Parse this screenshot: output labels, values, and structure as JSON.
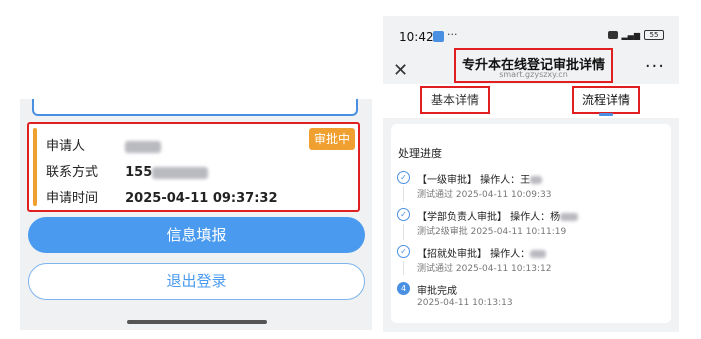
{
  "left": {
    "status_badge": "审批中",
    "rows": [
      {
        "label": "申请人",
        "value": ""
      },
      {
        "label": "联系方式",
        "value": "155"
      },
      {
        "label": "申请时间",
        "value": "2025-04-11 09:37:32"
      }
    ],
    "primary_button": "信息填报",
    "secondary_button": "退出登录"
  },
  "right": {
    "status_bar": {
      "time": "10:42",
      "dots": "···",
      "battery": "55"
    },
    "nav": {
      "close": "✕",
      "title": "专升本在线登记审批详情",
      "subtitle": "smart.gzyszxy.cn",
      "more": "···"
    },
    "tabs": [
      {
        "label": "基本详情"
      },
      {
        "label": "流程详情"
      }
    ],
    "process_title": "处理进度",
    "steps": [
      {
        "icon": "✓",
        "title": "【一级审批】 操作人：王",
        "detail": "测试通过 2025-04-11 10:09:33"
      },
      {
        "icon": "✓",
        "title": "【学部负责人审批】 操作人：杨",
        "detail": "测试2级审批 2025-04-11 10:11:19"
      },
      {
        "icon": "✓",
        "title": "【招就处审批】 操作人：",
        "detail": "测试通过 2025-04-11 10:13:12"
      },
      {
        "icon": "4",
        "title": "审批完成",
        "detail": "2025-04-11 10:13:13"
      }
    ]
  },
  "colors": {
    "accent": "#4a9bf0",
    "badge": "#f0a030",
    "highlight": "#e02020"
  }
}
